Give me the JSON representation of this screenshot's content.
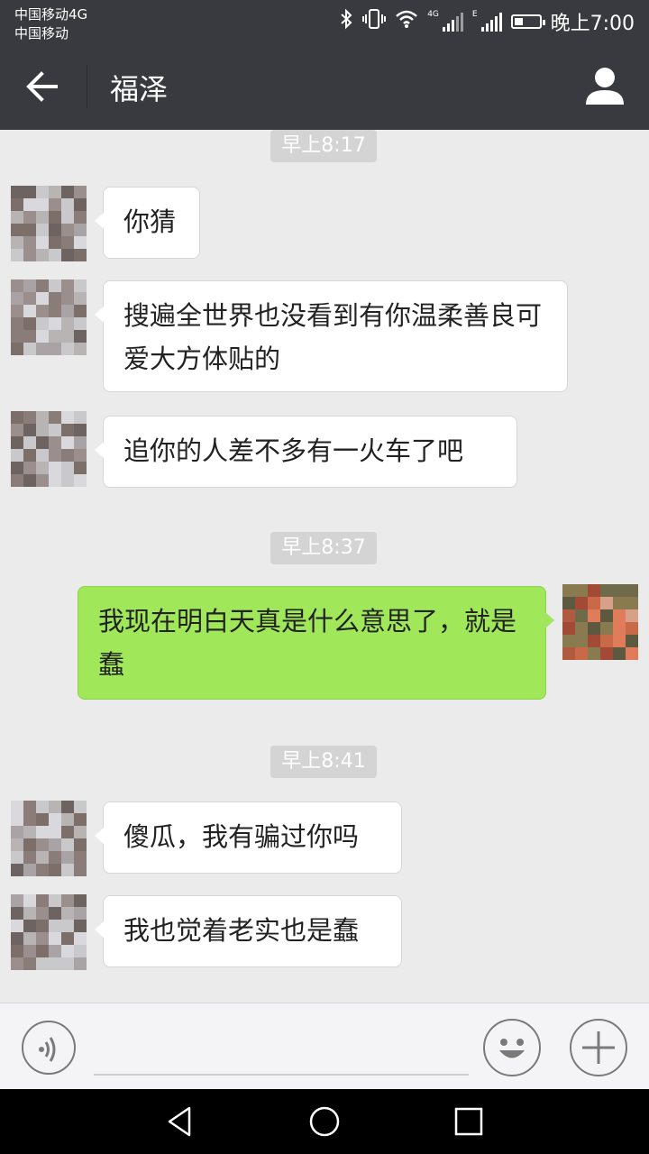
{
  "status_bar": {
    "carrier_1": "中国移动4G",
    "carrier_2": "中国移动",
    "network_label": "4G",
    "network_label_2": "E",
    "time": "晚上7:00",
    "battery_level": 0.35,
    "icons": [
      "bluetooth-icon",
      "vibrate-icon",
      "wifi-icon",
      "signal-icon",
      "signal-icon",
      "battery-icon"
    ]
  },
  "header": {
    "title": "福泽",
    "back_icon": "arrow-left-icon",
    "profile_icon": "person-icon"
  },
  "chat": {
    "timestamps": [
      "早上8:17",
      "早上8:37",
      "早上8:41"
    ],
    "messages": [
      {
        "side": "left",
        "text": "你猜"
      },
      {
        "side": "left",
        "text": "搜遍全世界也没看到有你温柔善良可爱大方体贴的"
      },
      {
        "side": "left",
        "text": "追你的人差不多有一火车了吧"
      },
      {
        "side": "right",
        "text": "我现在明白天真是什么意思了，就是蠢"
      },
      {
        "side": "left",
        "text": "傻瓜，我有骗过你吗"
      },
      {
        "side": "left",
        "text": "我也觉着老实也是蠢"
      }
    ]
  },
  "input_bar": {
    "voice_icon": "voice-icon",
    "emoji_icon": "smiley-icon",
    "more_icon": "plus-icon"
  },
  "nav_bar": {
    "icons": [
      "back-triangle-icon",
      "home-circle-icon",
      "recents-square-icon"
    ]
  },
  "colors": {
    "bar": "#393a3f",
    "chat_bg": "#ebebeb",
    "outgoing_bubble": "#a0e75a",
    "incoming_bubble": "#ffffff",
    "timestamp_bg": "#d4d4d4"
  }
}
